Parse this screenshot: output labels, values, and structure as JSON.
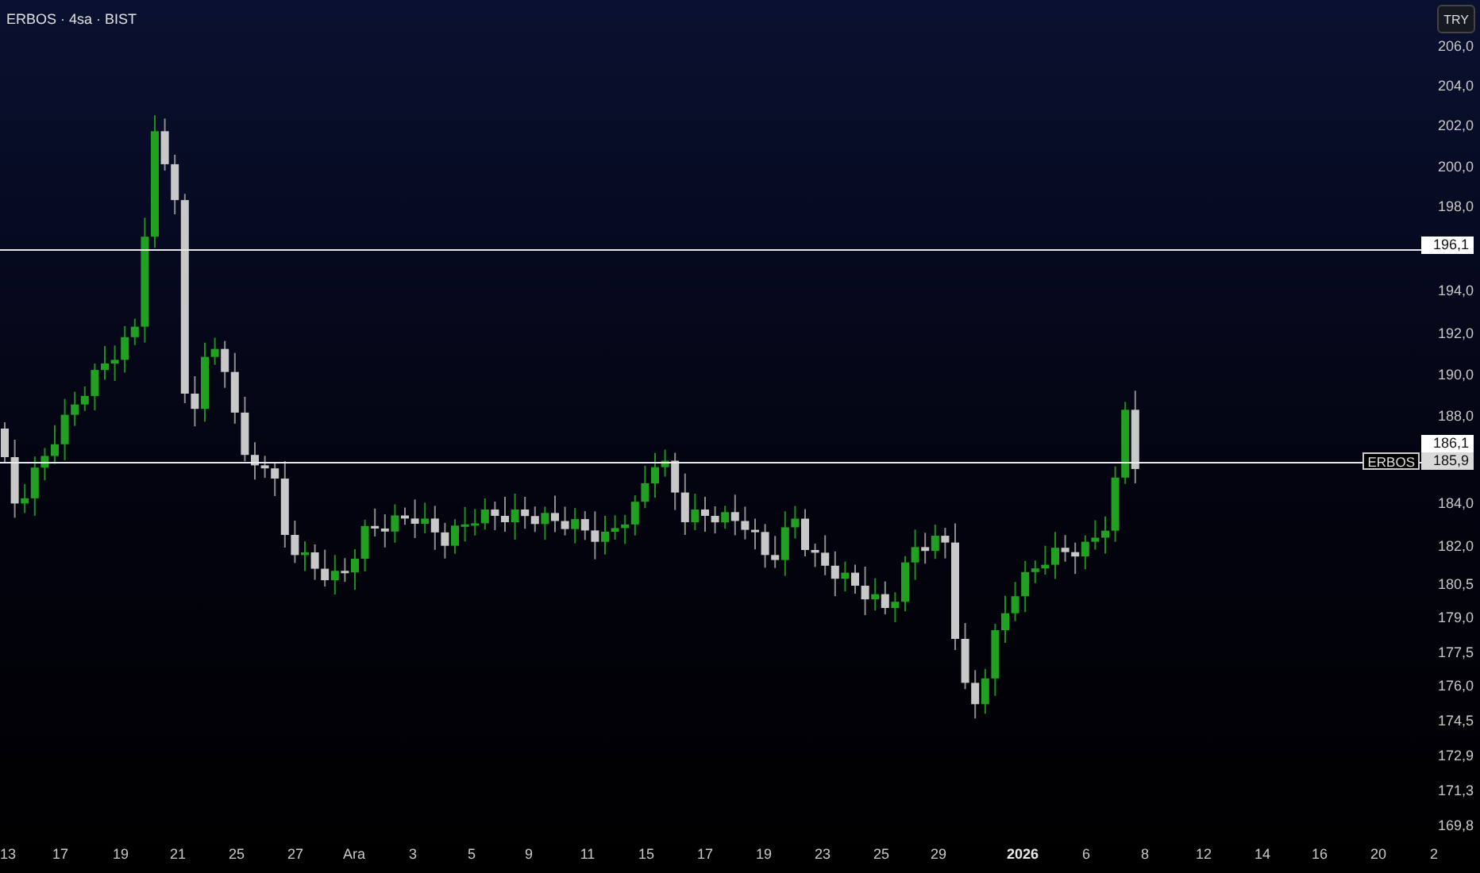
{
  "title": "ERBOS · 4sa · BIST",
  "currency_button": "TRY",
  "price_axis": [
    "206,0",
    "204,0",
    "202,0",
    "200,0",
    "198,0",
    "194,0",
    "192,0",
    "190,0",
    "188,0",
    "184,0",
    "182,0",
    "180,5",
    "179,0",
    "177,5",
    "176,0",
    "174,5",
    "172,9",
    "171,3",
    "169,8"
  ],
  "time_axis": [
    {
      "label": "13",
      "kind": "day"
    },
    {
      "label": "17",
      "kind": "day"
    },
    {
      "label": "19",
      "kind": "day"
    },
    {
      "label": "21",
      "kind": "day"
    },
    {
      "label": "25",
      "kind": "day"
    },
    {
      "label": "27",
      "kind": "day"
    },
    {
      "label": "Ara",
      "kind": "month"
    },
    {
      "label": "3",
      "kind": "day"
    },
    {
      "label": "5",
      "kind": "day"
    },
    {
      "label": "9",
      "kind": "day"
    },
    {
      "label": "11",
      "kind": "day"
    },
    {
      "label": "15",
      "kind": "day"
    },
    {
      "label": "17",
      "kind": "day"
    },
    {
      "label": "19",
      "kind": "day"
    },
    {
      "label": "23",
      "kind": "day"
    },
    {
      "label": "25",
      "kind": "day"
    },
    {
      "label": "29",
      "kind": "day"
    },
    {
      "label": "2026",
      "kind": "year"
    },
    {
      "label": "6",
      "kind": "day"
    },
    {
      "label": "8",
      "kind": "day"
    },
    {
      "label": "12",
      "kind": "day"
    },
    {
      "label": "14",
      "kind": "day"
    },
    {
      "label": "16",
      "kind": "day"
    },
    {
      "label": "20",
      "kind": "day"
    },
    {
      "label": "2",
      "kind": "day"
    }
  ],
  "level_line": {
    "price": "196,1"
  },
  "last_price": {
    "symbol": "ERBOS",
    "price": "185,9",
    "high": "186,1"
  }
}
